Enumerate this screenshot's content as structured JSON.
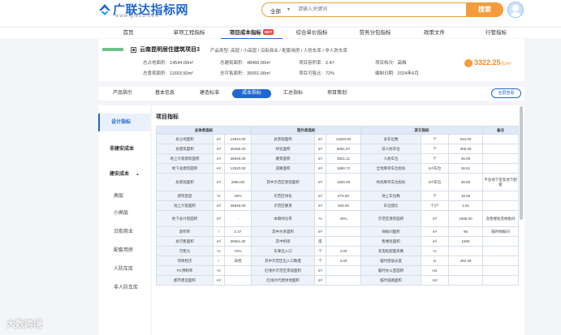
{
  "header": {
    "logo_text": "广联达指标网",
    "logo_sub": "www.gldzb.com",
    "search_type": "全部",
    "search_placeholder": "请输入关键词",
    "search_button": "搜索"
  },
  "nav": [
    "首页",
    "单项工程指标",
    "项目成本指标",
    "综合单价指标",
    "劳务分包指标",
    "政策文件",
    "行管指标"
  ],
  "nav_badge": "HOT",
  "project": {
    "title": "云南昆明居住建筑项目3",
    "type_label": "产品类型:",
    "type_value": "高层 / 小高层 / 沿街商业 / 配套用房 / 人防车库 / 非人防车库",
    "fields": [
      {
        "label": "总占地面积:",
        "value": "14544.00m²"
      },
      {
        "label": "总建筑面积:",
        "value": "48466.00m²"
      },
      {
        "label": "项目容积率:",
        "value": "2.47"
      },
      {
        "label": "项目档次:",
        "value": "高档"
      },
      {
        "label": "总景观面积:",
        "value": "11693.50m²"
      },
      {
        "label": "总可售面积:",
        "value": "35061.00m²"
      },
      {
        "label": "项目可售比:",
        "value": "72%"
      },
      {
        "label": "编制日期:",
        "value": "2024年6月"
      }
    ],
    "price": "3322.25",
    "price_unit": "元/m²"
  },
  "tabs": [
    "产品指引",
    "基本信息",
    "建造标准",
    "成本指标",
    "汇总指标",
    "项目策划"
  ],
  "fullscreen_label": "全屏查看",
  "sidebar": {
    "items": [
      "设计指标",
      "非建安成本",
      "建安成本",
      "高层",
      "小高层",
      "沿街商业",
      "配套用房",
      "人防车库",
      "非人防车库"
    ]
  },
  "main": {
    "title": "项目指标",
    "group_headers": [
      "总体类指标",
      "室外类指标",
      "其它指标",
      "备注"
    ],
    "rows": [
      [
        "总占地面积",
        "m²",
        "14544.00",
        "总景观面积",
        "m²",
        "11693.50",
        "总车位数",
        "个",
        "342.00",
        ""
      ],
      [
        "总建筑面积",
        "m²",
        "48466.00",
        "绿化面积",
        "m²",
        "5881.67",
        "非人防车位",
        "个",
        "306.00",
        ""
      ],
      [
        "地上计容建筑面积",
        "m²",
        "35946.00",
        "硬景面积",
        "m²",
        "3921.11",
        "人防车位",
        "个",
        "36.00",
        ""
      ],
      [
        "地下总建筑面积",
        "m²",
        "12520.00",
        "道路面积",
        "m²",
        "1890.72",
        "全地库单车位指标",
        "m²/车位",
        "36.61",
        ""
      ],
      [
        "总景观面积",
        "m²",
        "2850.50",
        "其中示范区景观面积",
        "m²",
        "1500.00",
        "纯地库单车位指标",
        "m²/车位",
        "30.60",
        "不含地下室及地下配套"
      ],
      [
        "建筑密度",
        "%",
        "20%",
        "示范区绿化",
        "m²",
        "675.00",
        "地上车位数",
        "个",
        "18.00",
        ""
      ],
      [
        "地上计容面积",
        "m²",
        "35946.00",
        "示范区硬景",
        "m²",
        "825.00",
        "车位配比",
        "个/户",
        "1.01",
        ""
      ],
      [
        "地下总计容面积",
        "m²",
        "-",
        "本期绿化率",
        "%",
        "40%",
        "示范区建筑面积",
        "m²",
        "1685.00",
        "含售楼处及样板间"
      ],
      [
        "容积率",
        "/",
        "2.47",
        "其中水系面积",
        "m²",
        "",
        "样板间面积",
        "m²",
        "95",
        "临时样板间"
      ],
      [
        "总可售面积",
        "m²",
        "35061.00",
        "其中桥梁",
        "座",
        "",
        "售楼处面积",
        "m²",
        "1600",
        ""
      ],
      [
        "可售比",
        "%",
        "72%",
        "车库出入口",
        "个",
        "3.00",
        "充电桩配置系数",
        "%",
        "",
        ""
      ],
      [
        "项目档次",
        "/",
        "高档",
        "其中示范区出入口数量",
        "个",
        "3.00",
        "临时围墙长度",
        "m",
        "482.39",
        ""
      ],
      [
        "PC预制率",
        "%",
        "",
        "红线外示范区景观面积",
        "m²",
        "",
        "临时办公室面积",
        "m2",
        "",
        ""
      ],
      [
        "都市建造面积",
        "m²",
        "",
        "红线外代建绿地面积",
        "m²",
        "",
        "临时道路面积",
        "m2",
        "",
        ""
      ]
    ]
  },
  "watermark": "大数跨境"
}
